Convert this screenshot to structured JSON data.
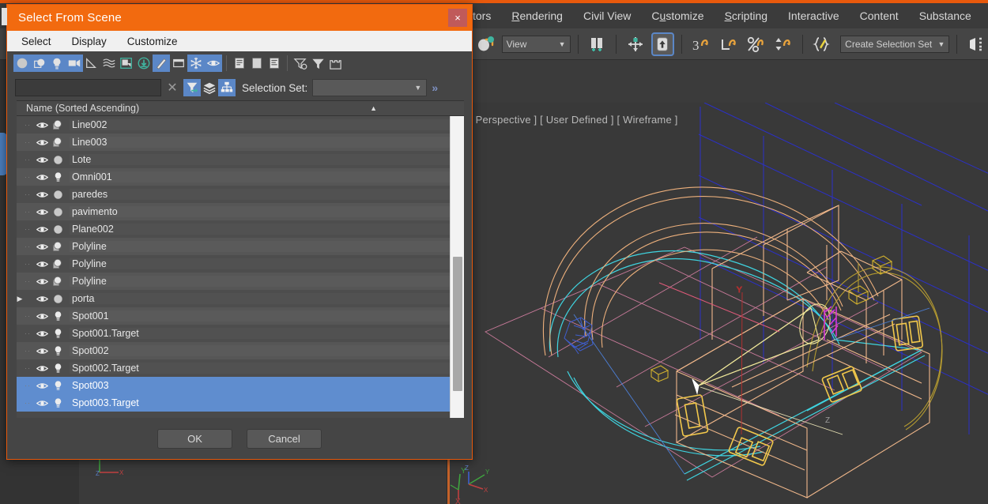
{
  "app": {
    "menubar": [
      {
        "label": "tors",
        "mnemonic": ""
      },
      {
        "label": "Rendering",
        "mnemonic": "R"
      },
      {
        "label": "Civil View",
        "mnemonic": ""
      },
      {
        "label": "Customize",
        "mnemonic": "u"
      },
      {
        "label": "Scripting",
        "mnemonic": "S"
      },
      {
        "label": "Interactive",
        "mnemonic": ""
      },
      {
        "label": "Content",
        "mnemonic": ""
      },
      {
        "label": "Substance",
        "mnemonic": ""
      }
    ],
    "toolbar": {
      "reference_coord_value": "View",
      "selection_set_value": "Create Selection Set",
      "icons": [
        "select-and-link-icon",
        "bind-to-space-warp-icon",
        "select-object-icon",
        "select-and-move-icon",
        "select-and-rotate-icon",
        "select-and-scale-icon",
        "select-and-place-icon",
        "named-selection-sets-icon",
        "mirror-icon"
      ]
    },
    "viewport": {
      "label": "[ Perspective ] [ User Defined ] [ Wireframe ]",
      "axis_labels": [
        "X",
        "Y",
        "Z"
      ]
    }
  },
  "dialog": {
    "title": "Select From Scene",
    "close_label": "×",
    "menus": [
      "Select",
      "Display",
      "Customize"
    ],
    "toolbar_icons": [
      {
        "name": "display-geometry-icon",
        "active": true
      },
      {
        "name": "display-shapes-icon",
        "active": true
      },
      {
        "name": "display-lights-icon",
        "active": true
      },
      {
        "name": "display-cameras-icon",
        "active": true
      },
      {
        "name": "display-helpers-icon",
        "active": false
      },
      {
        "name": "display-space-warps-icon",
        "active": false
      },
      {
        "name": "display-groups-xrefs-icon",
        "active": false
      },
      {
        "name": "display-external-references-icon",
        "active": false
      },
      {
        "name": "display-bone-objects-icon",
        "active": true
      },
      {
        "name": "display-containers-icon",
        "active": false
      },
      {
        "name": "display-frozen-objects-icon",
        "active": true
      },
      {
        "name": "display-hidden-objects-icon",
        "active": true
      },
      {
        "name": "expand-all-icon",
        "active": false
      },
      {
        "name": "collapse-all-icon",
        "active": false
      },
      {
        "name": "expand-selected-icon",
        "active": false
      },
      {
        "name": "configure-filter-icon",
        "active": false
      },
      {
        "name": "filter-icon",
        "active": false
      },
      {
        "name": "toolbar-options-icon",
        "active": false
      }
    ],
    "find": {
      "value": "",
      "placeholder": ""
    },
    "clear_label": "✕",
    "filter_toggle_icons": [
      {
        "name": "select-subtree-icon",
        "active": true
      },
      {
        "name": "layers-icon",
        "active": false
      },
      {
        "name": "hierarchy-icon",
        "active": true
      }
    ],
    "selection_set": {
      "label": "Selection Set:",
      "value": ""
    },
    "overflow_label": "»",
    "list": {
      "header": "Name (Sorted Ascending)",
      "sort_arrow": "▲",
      "rows": [
        {
          "name": "Line002",
          "type": "shape",
          "selected": false,
          "expandable": false
        },
        {
          "name": "Line003",
          "type": "shape",
          "selected": false,
          "expandable": false
        },
        {
          "name": "Lote",
          "type": "geometry",
          "selected": false,
          "expandable": false
        },
        {
          "name": "Omni001",
          "type": "light",
          "selected": false,
          "expandable": false
        },
        {
          "name": "paredes",
          "type": "geometry",
          "selected": false,
          "expandable": false
        },
        {
          "name": "pavimento",
          "type": "geometry",
          "selected": false,
          "expandable": false
        },
        {
          "name": "Plane002",
          "type": "geometry",
          "selected": false,
          "expandable": false
        },
        {
          "name": "Polyline",
          "type": "shape",
          "selected": false,
          "expandable": false
        },
        {
          "name": "Polyline",
          "type": "shape",
          "selected": false,
          "expandable": false
        },
        {
          "name": "Polyline",
          "type": "shape",
          "selected": false,
          "expandable": false
        },
        {
          "name": "porta",
          "type": "geometry",
          "selected": false,
          "expandable": true
        },
        {
          "name": "Spot001",
          "type": "light",
          "selected": false,
          "expandable": false
        },
        {
          "name": "Spot001.Target",
          "type": "light",
          "selected": false,
          "expandable": false
        },
        {
          "name": "Spot002",
          "type": "light",
          "selected": false,
          "expandable": false
        },
        {
          "name": "Spot002.Target",
          "type": "light",
          "selected": false,
          "expandable": false
        },
        {
          "name": "Spot003",
          "type": "light",
          "selected": true,
          "expandable": false
        },
        {
          "name": "Spot003.Target",
          "type": "light",
          "selected": true,
          "expandable": false
        }
      ]
    },
    "buttons": {
      "ok": "OK",
      "cancel": "Cancel"
    }
  },
  "colors": {
    "titlebar": "#f26a0f",
    "dialog_border": "#e8590c",
    "selection_blue": "#5f8dcf",
    "toolbar_active": "#5b87c7",
    "close_red": "#c05a5a",
    "panel_bg": "#454545",
    "viewport_bg": "#393939"
  }
}
